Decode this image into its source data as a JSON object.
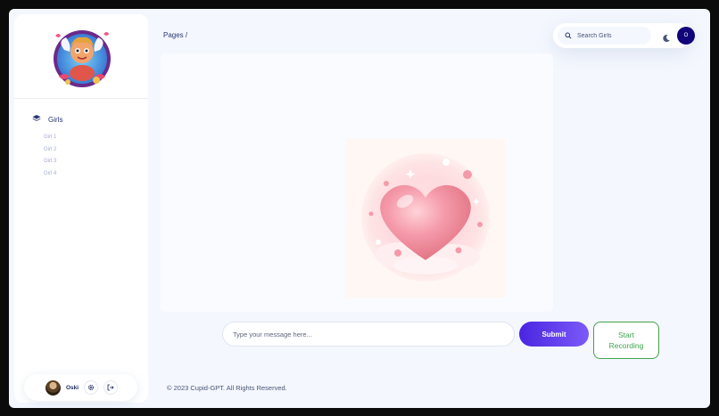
{
  "sidebar": {
    "logo_icon": "cupid-logo-icon",
    "nav": {
      "main_label": "Girls",
      "main_icon": "layers-icon",
      "items": [
        {
          "label": "Girl 1"
        },
        {
          "label": "Girl 2"
        },
        {
          "label": "Girl 3"
        },
        {
          "label": "Girl 4"
        }
      ]
    },
    "user": {
      "name": "Oski",
      "settings_icon": "gear-icon",
      "logout_icon": "logout-icon"
    }
  },
  "header": {
    "breadcrumb": "Pages  /",
    "search_placeholder": "Search Girls",
    "theme_icon": "moon-icon",
    "avatar_initial": "O"
  },
  "main": {
    "image_icon": "heart-illustration",
    "message_placeholder": "Type your message here...",
    "submit_label": "Submit",
    "record_label_line1": "Start",
    "record_label_line2": "Recording"
  },
  "footer": {
    "text": "© 2023 Cupid-GPT. All Rights Reserved."
  },
  "colors": {
    "accent": "#4a25e1",
    "record": "#3fa34d",
    "text_dark": "#2b3674",
    "avatar_bg": "#11047a"
  }
}
